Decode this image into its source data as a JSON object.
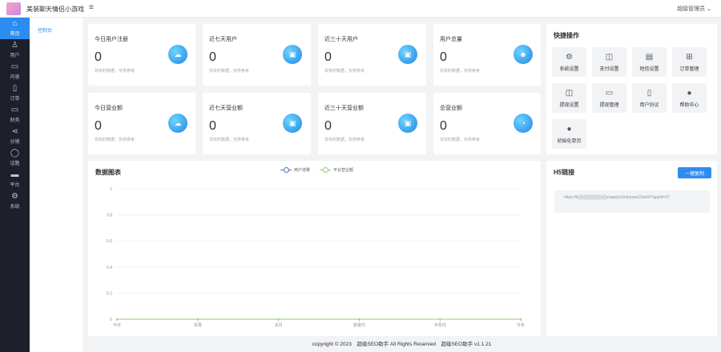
{
  "header": {
    "app_title": "美装聊天情侣小游戏",
    "menu_icon": "hamburger-icon",
    "admin_label": "超级管理员 ⌄"
  },
  "sidebar": {
    "items": [
      {
        "label": "首页",
        "icon": "home-icon",
        "active": true
      },
      {
        "label": "用户",
        "icon": "user-icon"
      },
      {
        "label": "内容",
        "icon": "folder-icon"
      },
      {
        "label": "订单",
        "icon": "document-icon"
      },
      {
        "label": "财务",
        "icon": "folder-icon"
      },
      {
        "label": "分销",
        "icon": "share-icon"
      },
      {
        "label": "话题",
        "icon": "chat-icon"
      },
      {
        "label": "平台",
        "icon": "monitor-icon"
      },
      {
        "label": "系统",
        "icon": "gear-icon"
      }
    ]
  },
  "subnav": {
    "item": "控制台"
  },
  "stats": [
    {
      "title": "今日用户注册",
      "value": "0",
      "note": "非实时数据，仅供参考"
    },
    {
      "title": "近七天用户",
      "value": "0",
      "note": "非实时数据，仅供参考"
    },
    {
      "title": "近三十天用户",
      "value": "0",
      "note": "非实时数据，仅供参考"
    },
    {
      "title": "用户总量",
      "value": "0",
      "note": "非实时数据，仅供参考"
    },
    {
      "title": "今日营业额",
      "value": "0",
      "note": "非实时数据，仅供参考"
    },
    {
      "title": "近七天营业额",
      "value": "0",
      "note": "非实时数据，仅供参考"
    },
    {
      "title": "近三十天营业额",
      "value": "0",
      "note": "非实时数据，仅供参考"
    },
    {
      "title": "总营业额",
      "value": "0",
      "note": "非实时数据，仅供参考"
    }
  ],
  "quick_actions": {
    "title": "快捷操作",
    "items": [
      {
        "label": "系统设置",
        "icon": "gear-icon"
      },
      {
        "label": "支付设置",
        "icon": "wallet-icon"
      },
      {
        "label": "短信设置",
        "icon": "message-icon"
      },
      {
        "label": "订单管理",
        "icon": "gift-icon"
      },
      {
        "label": "提现设置",
        "icon": "wallet-icon"
      },
      {
        "label": "提现管理",
        "icon": "folder-icon"
      },
      {
        "label": "用户协议",
        "icon": "document-icon"
      },
      {
        "label": "帮助中心",
        "icon": "help-icon"
      },
      {
        "label": "初始化单页",
        "icon": "help-icon"
      }
    ]
  },
  "h5": {
    "title": "H5链接",
    "copy_button": "一键复制",
    "url": "https://k▒▒▒▒▒▒▒▒▒▒s/app/jc/UnknownChat/#/?appid=37"
  },
  "chart_data": {
    "type": "line",
    "title": "数据图表",
    "categories": [
      "今日",
      "本周",
      "本月",
      "季度内",
      "半年内",
      "今年"
    ],
    "series": [
      {
        "name": "用户增量",
        "values": [
          0,
          0,
          0,
          0,
          0,
          0
        ],
        "color": "#5470c6"
      },
      {
        "name": "平台营业额",
        "values": [
          0,
          0,
          0,
          0,
          0,
          0
        ],
        "color": "#91cc75"
      }
    ],
    "yticks": [
      "0",
      "0.2",
      "0.4",
      "0.6",
      "0.8",
      "1"
    ],
    "ylim": [
      0,
      1
    ],
    "grid": true,
    "legend": "top-center"
  },
  "footer": {
    "text": "copyright © 2023　超级SEO助手 All Rights Reserved　超级SEO助手 v1.1.21"
  }
}
